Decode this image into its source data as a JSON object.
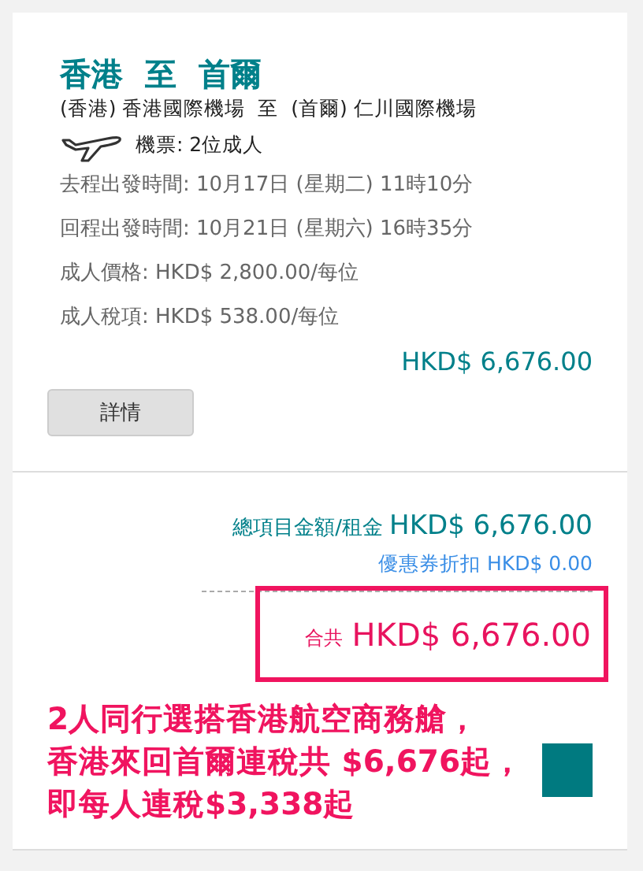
{
  "trip": {
    "title": "香港  至  首爾",
    "route": "(香港) 香港國際機場  至  (首爾) 仁川國際機場",
    "tickets": "機票: 2位成人",
    "details": [
      "去程出發時間: 10月17日 (星期二) 11時10分",
      "回程出發時間: 10月21日 (星期六) 16時35分",
      "成人價格: HKD$ 2,800.00/每位",
      "成人稅項: HKD$ 538.00/每位"
    ],
    "subtotal": "HKD$ 6,676.00",
    "details_button": "詳情"
  },
  "summary": {
    "total_label": "總項目金額/租金",
    "total_value": "HKD$ 6,676.00",
    "coupon": "優惠券折扣 HKD$ 0.00",
    "grand_label": "合共",
    "grand_value": "HKD$ 6,676.00"
  },
  "caption": [
    "2人同行選搭香港航空商務艙，",
    "香港來回首爾連稅共 $6,676起，",
    "即每人連稅$3,338起"
  ]
}
